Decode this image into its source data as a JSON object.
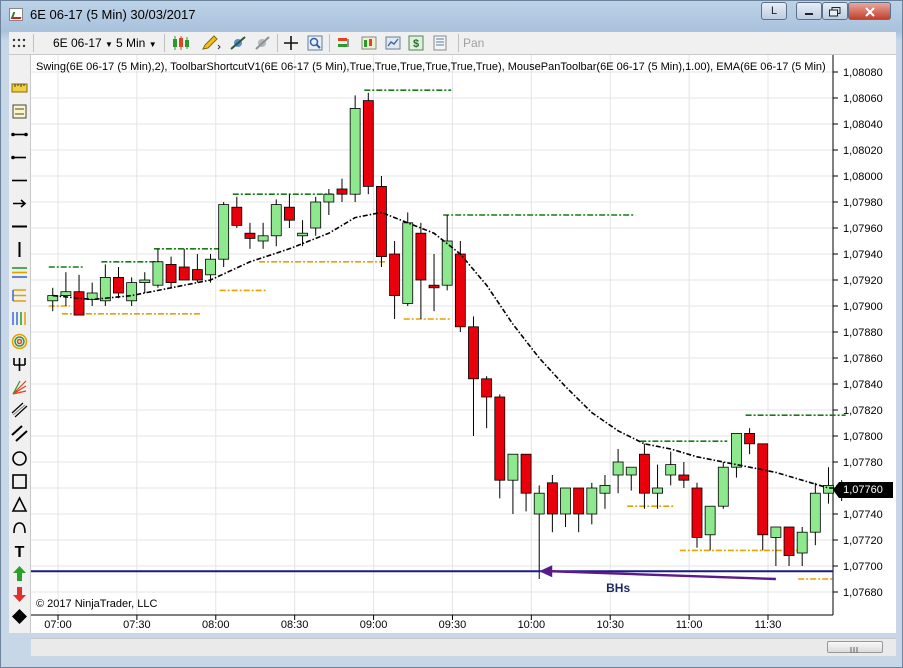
{
  "window": {
    "title": "6E 06-17 (5 Min)  30/03/2017",
    "btn_l": "L"
  },
  "toolbar": {
    "instrument": "6E 06-17",
    "interval": "5 Min",
    "pan_label": "Pan"
  },
  "chart": {
    "indicator_label": "Swing(6E 06-17 (5 Min),2), ToolbarShortcutV1(6E 06-17 (5 Min),True,True,True,True,True,True), MousePanToolbar(6E 06-17 (5 Min),1.00), EMA(6E 06-17 (5 Min)",
    "copyright": "© 2017 NinjaTrader, LLC",
    "annotation": "BHs",
    "last_price": "1,07760"
  },
  "chart_data": {
    "type": "candlestick",
    "instrument": "6E 06-17",
    "interval": "5 Min",
    "date": "30/03/2017",
    "y_axis_labels": [
      "1,08080",
      "1,08060",
      "1,08040",
      "1,08020",
      "1,08000",
      "1,07980",
      "1,07960",
      "1,07940",
      "1,07920",
      "1,07900",
      "1,07880",
      "1,07860",
      "1,07840",
      "1,07820",
      "1,07800",
      "1,07780",
      "1,07760",
      "1,07740",
      "1,07720",
      "1,07700",
      "1,07680"
    ],
    "ylim": [
      1.0767,
      1.0809
    ],
    "x_axis_labels": [
      "07:00",
      "07:30",
      "08:00",
      "08:30",
      "09:00",
      "09:30",
      "10:00",
      "10:30",
      "11:00",
      "11:30"
    ],
    "colors": {
      "up": "#8ee88e",
      "down": "#e8000b",
      "ema": "#000000",
      "swing_high": "#1a7a1a",
      "swing_low": "#e8a000",
      "hline": "#1a1a8c",
      "arrow": "#5a1a8a"
    },
    "candles": [
      {
        "t": "06:58",
        "o": 1.07904,
        "h": 1.07914,
        "l": 1.07896,
        "c": 1.07908
      },
      {
        "t": "07:03",
        "o": 1.07908,
        "h": 1.07926,
        "l": 1.079,
        "c": 1.07911
      },
      {
        "t": "07:08",
        "o": 1.07911,
        "h": 1.07924,
        "l": 1.07895,
        "c": 1.07893
      },
      {
        "t": "07:13",
        "o": 1.07905,
        "h": 1.07918,
        "l": 1.079,
        "c": 1.0791
      },
      {
        "t": "07:18",
        "o": 1.07904,
        "h": 1.07932,
        "l": 1.079,
        "c": 1.07922
      },
      {
        "t": "07:23",
        "o": 1.07922,
        "h": 1.0793,
        "l": 1.07906,
        "c": 1.0791
      },
      {
        "t": "07:28",
        "o": 1.07904,
        "h": 1.07922,
        "l": 1.079,
        "c": 1.07918
      },
      {
        "t": "07:33",
        "o": 1.07918,
        "h": 1.07926,
        "l": 1.0791,
        "c": 1.0792
      },
      {
        "t": "07:38",
        "o": 1.07916,
        "h": 1.07944,
        "l": 1.07914,
        "c": 1.07934
      },
      {
        "t": "07:43",
        "o": 1.07932,
        "h": 1.07938,
        "l": 1.07914,
        "c": 1.07918
      },
      {
        "t": "07:48",
        "o": 1.0793,
        "h": 1.07944,
        "l": 1.0792,
        "c": 1.0792
      },
      {
        "t": "07:53",
        "o": 1.07928,
        "h": 1.0794,
        "l": 1.07918,
        "c": 1.0792
      },
      {
        "t": "07:58",
        "o": 1.07924,
        "h": 1.0794,
        "l": 1.07918,
        "c": 1.07936
      },
      {
        "t": "08:03",
        "o": 1.07936,
        "h": 1.0798,
        "l": 1.0793,
        "c": 1.07978
      },
      {
        "t": "08:08",
        "o": 1.07976,
        "h": 1.07984,
        "l": 1.0796,
        "c": 1.07962
      },
      {
        "t": "08:13",
        "o": 1.07956,
        "h": 1.07964,
        "l": 1.07944,
        "c": 1.07952
      },
      {
        "t": "08:18",
        "o": 1.0795,
        "h": 1.07964,
        "l": 1.07944,
        "c": 1.07954
      },
      {
        "t": "08:23",
        "o": 1.07954,
        "h": 1.07982,
        "l": 1.07946,
        "c": 1.07978
      },
      {
        "t": "08:28",
        "o": 1.07976,
        "h": 1.07986,
        "l": 1.0796,
        "c": 1.07966
      },
      {
        "t": "08:33",
        "o": 1.07954,
        "h": 1.07966,
        "l": 1.07946,
        "c": 1.07956
      },
      {
        "t": "08:38",
        "o": 1.0796,
        "h": 1.07984,
        "l": 1.07954,
        "c": 1.0798
      },
      {
        "t": "08:43",
        "o": 1.0798,
        "h": 1.0799,
        "l": 1.0797,
        "c": 1.07986
      },
      {
        "t": "08:48",
        "o": 1.0799,
        "h": 1.07998,
        "l": 1.0798,
        "c": 1.07986
      },
      {
        "t": "08:53",
        "o": 1.07986,
        "h": 1.08062,
        "l": 1.0798,
        "c": 1.08052
      },
      {
        "t": "08:58",
        "o": 1.08058,
        "h": 1.08064,
        "l": 1.07986,
        "c": 1.07992
      },
      {
        "t": "09:03",
        "o": 1.07992,
        "h": 1.08,
        "l": 1.0793,
        "c": 1.07938
      },
      {
        "t": "09:08",
        "o": 1.0794,
        "h": 1.0795,
        "l": 1.0789,
        "c": 1.07908
      },
      {
        "t": "09:13",
        "o": 1.07902,
        "h": 1.07972,
        "l": 1.079,
        "c": 1.07964
      },
      {
        "t": "09:18",
        "o": 1.07956,
        "h": 1.07964,
        "l": 1.0789,
        "c": 1.0792
      },
      {
        "t": "09:23",
        "o": 1.07916,
        "h": 1.0794,
        "l": 1.07896,
        "c": 1.07914
      },
      {
        "t": "09:28",
        "o": 1.07916,
        "h": 1.0797,
        "l": 1.07912,
        "c": 1.0795
      },
      {
        "t": "09:33",
        "o": 1.0794,
        "h": 1.0795,
        "l": 1.0788,
        "c": 1.07884
      },
      {
        "t": "09:38",
        "o": 1.07884,
        "h": 1.07892,
        "l": 1.078,
        "c": 1.07844
      },
      {
        "t": "09:43",
        "o": 1.07844,
        "h": 1.07846,
        "l": 1.07806,
        "c": 1.0783
      },
      {
        "t": "09:48",
        "o": 1.0783,
        "h": 1.07832,
        "l": 1.07752,
        "c": 1.07766
      },
      {
        "t": "09:53",
        "o": 1.07766,
        "h": 1.07786,
        "l": 1.0774,
        "c": 1.07786
      },
      {
        "t": "09:58",
        "o": 1.07786,
        "h": 1.07786,
        "l": 1.07742,
        "c": 1.07756
      },
      {
        "t": "10:03",
        "o": 1.0774,
        "h": 1.07762,
        "l": 1.0769,
        "c": 1.07756
      },
      {
        "t": "10:08",
        "o": 1.07764,
        "h": 1.0777,
        "l": 1.07726,
        "c": 1.0774
      },
      {
        "t": "10:13",
        "o": 1.0774,
        "h": 1.0776,
        "l": 1.0773,
        "c": 1.0776
      },
      {
        "t": "10:18",
        "o": 1.0776,
        "h": 1.0776,
        "l": 1.07726,
        "c": 1.0774
      },
      {
        "t": "10:23",
        "o": 1.0774,
        "h": 1.07764,
        "l": 1.07732,
        "c": 1.0776
      },
      {
        "t": "10:28",
        "o": 1.07756,
        "h": 1.0777,
        "l": 1.07744,
        "c": 1.07762
      },
      {
        "t": "10:33",
        "o": 1.0777,
        "h": 1.0779,
        "l": 1.07756,
        "c": 1.0778
      },
      {
        "t": "10:38",
        "o": 1.0777,
        "h": 1.07776,
        "l": 1.07758,
        "c": 1.07776
      },
      {
        "t": "10:43",
        "o": 1.07786,
        "h": 1.07794,
        "l": 1.07744,
        "c": 1.07756
      },
      {
        "t": "10:48",
        "o": 1.07756,
        "h": 1.07778,
        "l": 1.07744,
        "c": 1.0776
      },
      {
        "t": "10:53",
        "o": 1.0777,
        "h": 1.07788,
        "l": 1.07762,
        "c": 1.07778
      },
      {
        "t": "10:58",
        "o": 1.0777,
        "h": 1.0778,
        "l": 1.0776,
        "c": 1.07766
      },
      {
        "t": "11:03",
        "o": 1.0776,
        "h": 1.07764,
        "l": 1.07714,
        "c": 1.07722
      },
      {
        "t": "11:08",
        "o": 1.07724,
        "h": 1.07746,
        "l": 1.07712,
        "c": 1.07746
      },
      {
        "t": "11:13",
        "o": 1.07746,
        "h": 1.0778,
        "l": 1.07744,
        "c": 1.07776
      },
      {
        "t": "11:18",
        "o": 1.07776,
        "h": 1.07802,
        "l": 1.07768,
        "c": 1.07802
      },
      {
        "t": "11:23",
        "o": 1.07802,
        "h": 1.07806,
        "l": 1.07786,
        "c": 1.07794
      },
      {
        "t": "11:28",
        "o": 1.07794,
        "h": 1.07794,
        "l": 1.07712,
        "c": 1.07724
      },
      {
        "t": "11:33",
        "o": 1.07722,
        "h": 1.07726,
        "l": 1.077,
        "c": 1.0773
      },
      {
        "t": "11:38",
        "o": 1.0773,
        "h": 1.0773,
        "l": 1.077,
        "c": 1.07708
      },
      {
        "t": "11:43",
        "o": 1.0771,
        "h": 1.0773,
        "l": 1.077,
        "c": 1.07726
      },
      {
        "t": "11:48",
        "o": 1.07726,
        "h": 1.07764,
        "l": 1.07716,
        "c": 1.07756
      },
      {
        "t": "11:53",
        "o": 1.07756,
        "h": 1.07776,
        "l": 1.07748,
        "c": 1.07762
      },
      {
        "t": "11:58",
        "o": 1.07756,
        "h": 1.07766,
        "l": 1.0775,
        "c": 1.07762
      }
    ],
    "ema": [
      {
        "t": "06:58",
        "v": 1.07908
      },
      {
        "t": "07:13",
        "v": 1.07905
      },
      {
        "t": "07:28",
        "v": 1.07908
      },
      {
        "t": "07:43",
        "v": 1.07914
      },
      {
        "t": "07:58",
        "v": 1.0792
      },
      {
        "t": "08:13",
        "v": 1.07934
      },
      {
        "t": "08:28",
        "v": 1.07944
      },
      {
        "t": "08:43",
        "v": 1.07956
      },
      {
        "t": "08:53",
        "v": 1.07968
      },
      {
        "t": "09:03",
        "v": 1.07972
      },
      {
        "t": "09:13",
        "v": 1.07964
      },
      {
        "t": "09:23",
        "v": 1.07956
      },
      {
        "t": "09:33",
        "v": 1.0794
      },
      {
        "t": "09:43",
        "v": 1.07916
      },
      {
        "t": "09:53",
        "v": 1.07886
      },
      {
        "t": "10:03",
        "v": 1.0786
      },
      {
        "t": "10:13",
        "v": 1.07838
      },
      {
        "t": "10:23",
        "v": 1.07818
      },
      {
        "t": "10:33",
        "v": 1.07804
      },
      {
        "t": "10:43",
        "v": 1.07794
      },
      {
        "t": "10:53",
        "v": 1.0779
      },
      {
        "t": "11:03",
        "v": 1.07784
      },
      {
        "t": "11:13",
        "v": 1.0778
      },
      {
        "t": "11:23",
        "v": 1.07776
      },
      {
        "t": "11:33",
        "v": 1.07772
      },
      {
        "t": "11:43",
        "v": 1.07766
      },
      {
        "t": "11:53",
        "v": 1.0776
      },
      {
        "t": "11:58",
        "v": 1.0776
      }
    ],
    "swing_highs": [
      {
        "from": "06:58",
        "to": "07:08",
        "y": 1.0793
      },
      {
        "from": "07:18",
        "to": "07:38",
        "y": 1.07934
      },
      {
        "from": "07:38",
        "to": "08:03",
        "y": 1.07944
      },
      {
        "from": "08:08",
        "to": "08:43",
        "y": 1.07986
      },
      {
        "from": "08:58",
        "to": "09:28",
        "y": 1.08066
      },
      {
        "from": "09:28",
        "to": "10:38",
        "y": 1.0797
      },
      {
        "from": "10:43",
        "to": "11:13",
        "y": 1.07796
      },
      {
        "from": "11:23",
        "to": "11:58",
        "y": 1.07816
      }
    ],
    "swing_lows": [
      {
        "from": "06:58",
        "to": "07:03",
        "y": 1.079
      },
      {
        "from": "07:03",
        "to": "07:53",
        "y": 1.07894
      },
      {
        "from": "08:03",
        "to": "08:18",
        "y": 1.07912
      },
      {
        "from": "08:18",
        "to": "09:03",
        "y": 1.07934
      },
      {
        "from": "09:13",
        "to": "09:28",
        "y": 1.0789
      },
      {
        "from": "10:38",
        "to": "10:53",
        "y": 1.07746
      },
      {
        "from": "10:58",
        "to": "11:43",
        "y": 1.07712
      },
      {
        "from": "11:43",
        "to": "11:53",
        "y": 1.0769
      }
    ],
    "horizontal_line": 1.07696,
    "arrow": {
      "from_t": "11:33",
      "from_y": 1.0769,
      "to_t": "10:03",
      "to_y": 1.07696
    },
    "annotation_position": {
      "t": "10:33",
      "y": 1.07683
    }
  }
}
